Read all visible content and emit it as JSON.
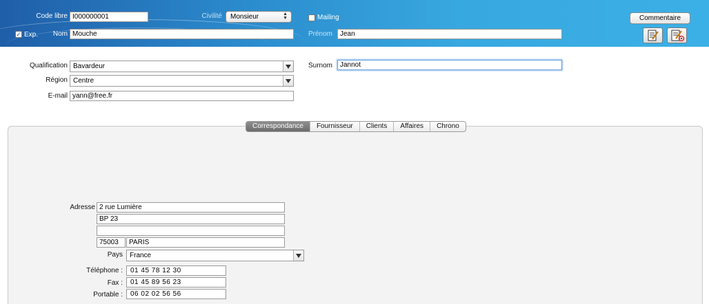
{
  "header": {
    "code_libre_label": "Code libre",
    "code_libre_value": "I000000001",
    "civilite_label": "Civilité",
    "civilite_value": "Monsieur",
    "mailing_label": "Mailing",
    "exp_label": "Exp.",
    "nom_label": "Nom",
    "nom_value": "Mouche",
    "prenom_label": "Prénom",
    "prenom_value": "Jean",
    "commentaire_label": "Commentaire"
  },
  "form": {
    "qualification_label": "Qualification",
    "qualification_value": "Bavardeur",
    "region_label": "Région",
    "region_value": "Centre",
    "email_label": "E-mail",
    "email_value": "yann@free.fr",
    "surnom_label": "Surnom",
    "surnom_value": "Jannot"
  },
  "tabs": [
    "Correspondance",
    "Fournisseur",
    "Clients",
    "Affaires",
    "Chrono"
  ],
  "address": {
    "adresse_label": "Adresse",
    "line1": "2 rue Lumière",
    "line2": "BP 23",
    "line3": "",
    "postal_code": "75003",
    "city": "PARIS",
    "pays_label": "Pays",
    "pays_value": "France",
    "telephone_label": "Téléphone :",
    "telephone_value": "01 45 78 12 30",
    "fax_label": "Fax :",
    "fax_value": "01 45 89 56 23",
    "portable_label": "Portable :",
    "portable_value": "06 02 02 56 56"
  },
  "icons": {
    "edit_note": "edit-note-icon",
    "edit_mail": "edit-mail-icon"
  },
  "colors": {
    "header_start": "#1f5ea8",
    "header_end": "#3bb0e6",
    "active_tab": "#7a7a7a"
  }
}
